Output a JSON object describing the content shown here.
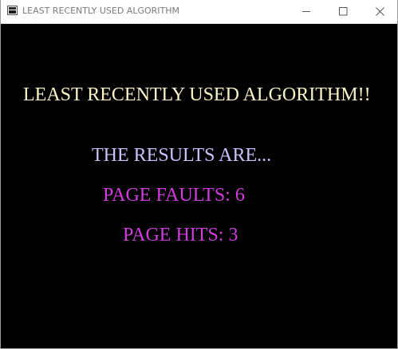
{
  "window": {
    "title": "LEAST RECENTLY USED ALGORITHM",
    "icon": "app-window-icon",
    "controls": {
      "minimize_icon": "minimize-icon",
      "maximize_icon": "maximize-icon",
      "close_icon": "close-icon"
    }
  },
  "output": {
    "heading": "LEAST RECENTLY USED ALGORITHM!!",
    "results_label": "THE RESULTS ARE...",
    "page_faults": "PAGE FAULTS: 6",
    "page_hits": "PAGE HITS: 3"
  },
  "colors": {
    "background": "#000000",
    "heading": "#fbf3c6",
    "results_label": "#c9c2ff",
    "stats": "#d23be0"
  }
}
